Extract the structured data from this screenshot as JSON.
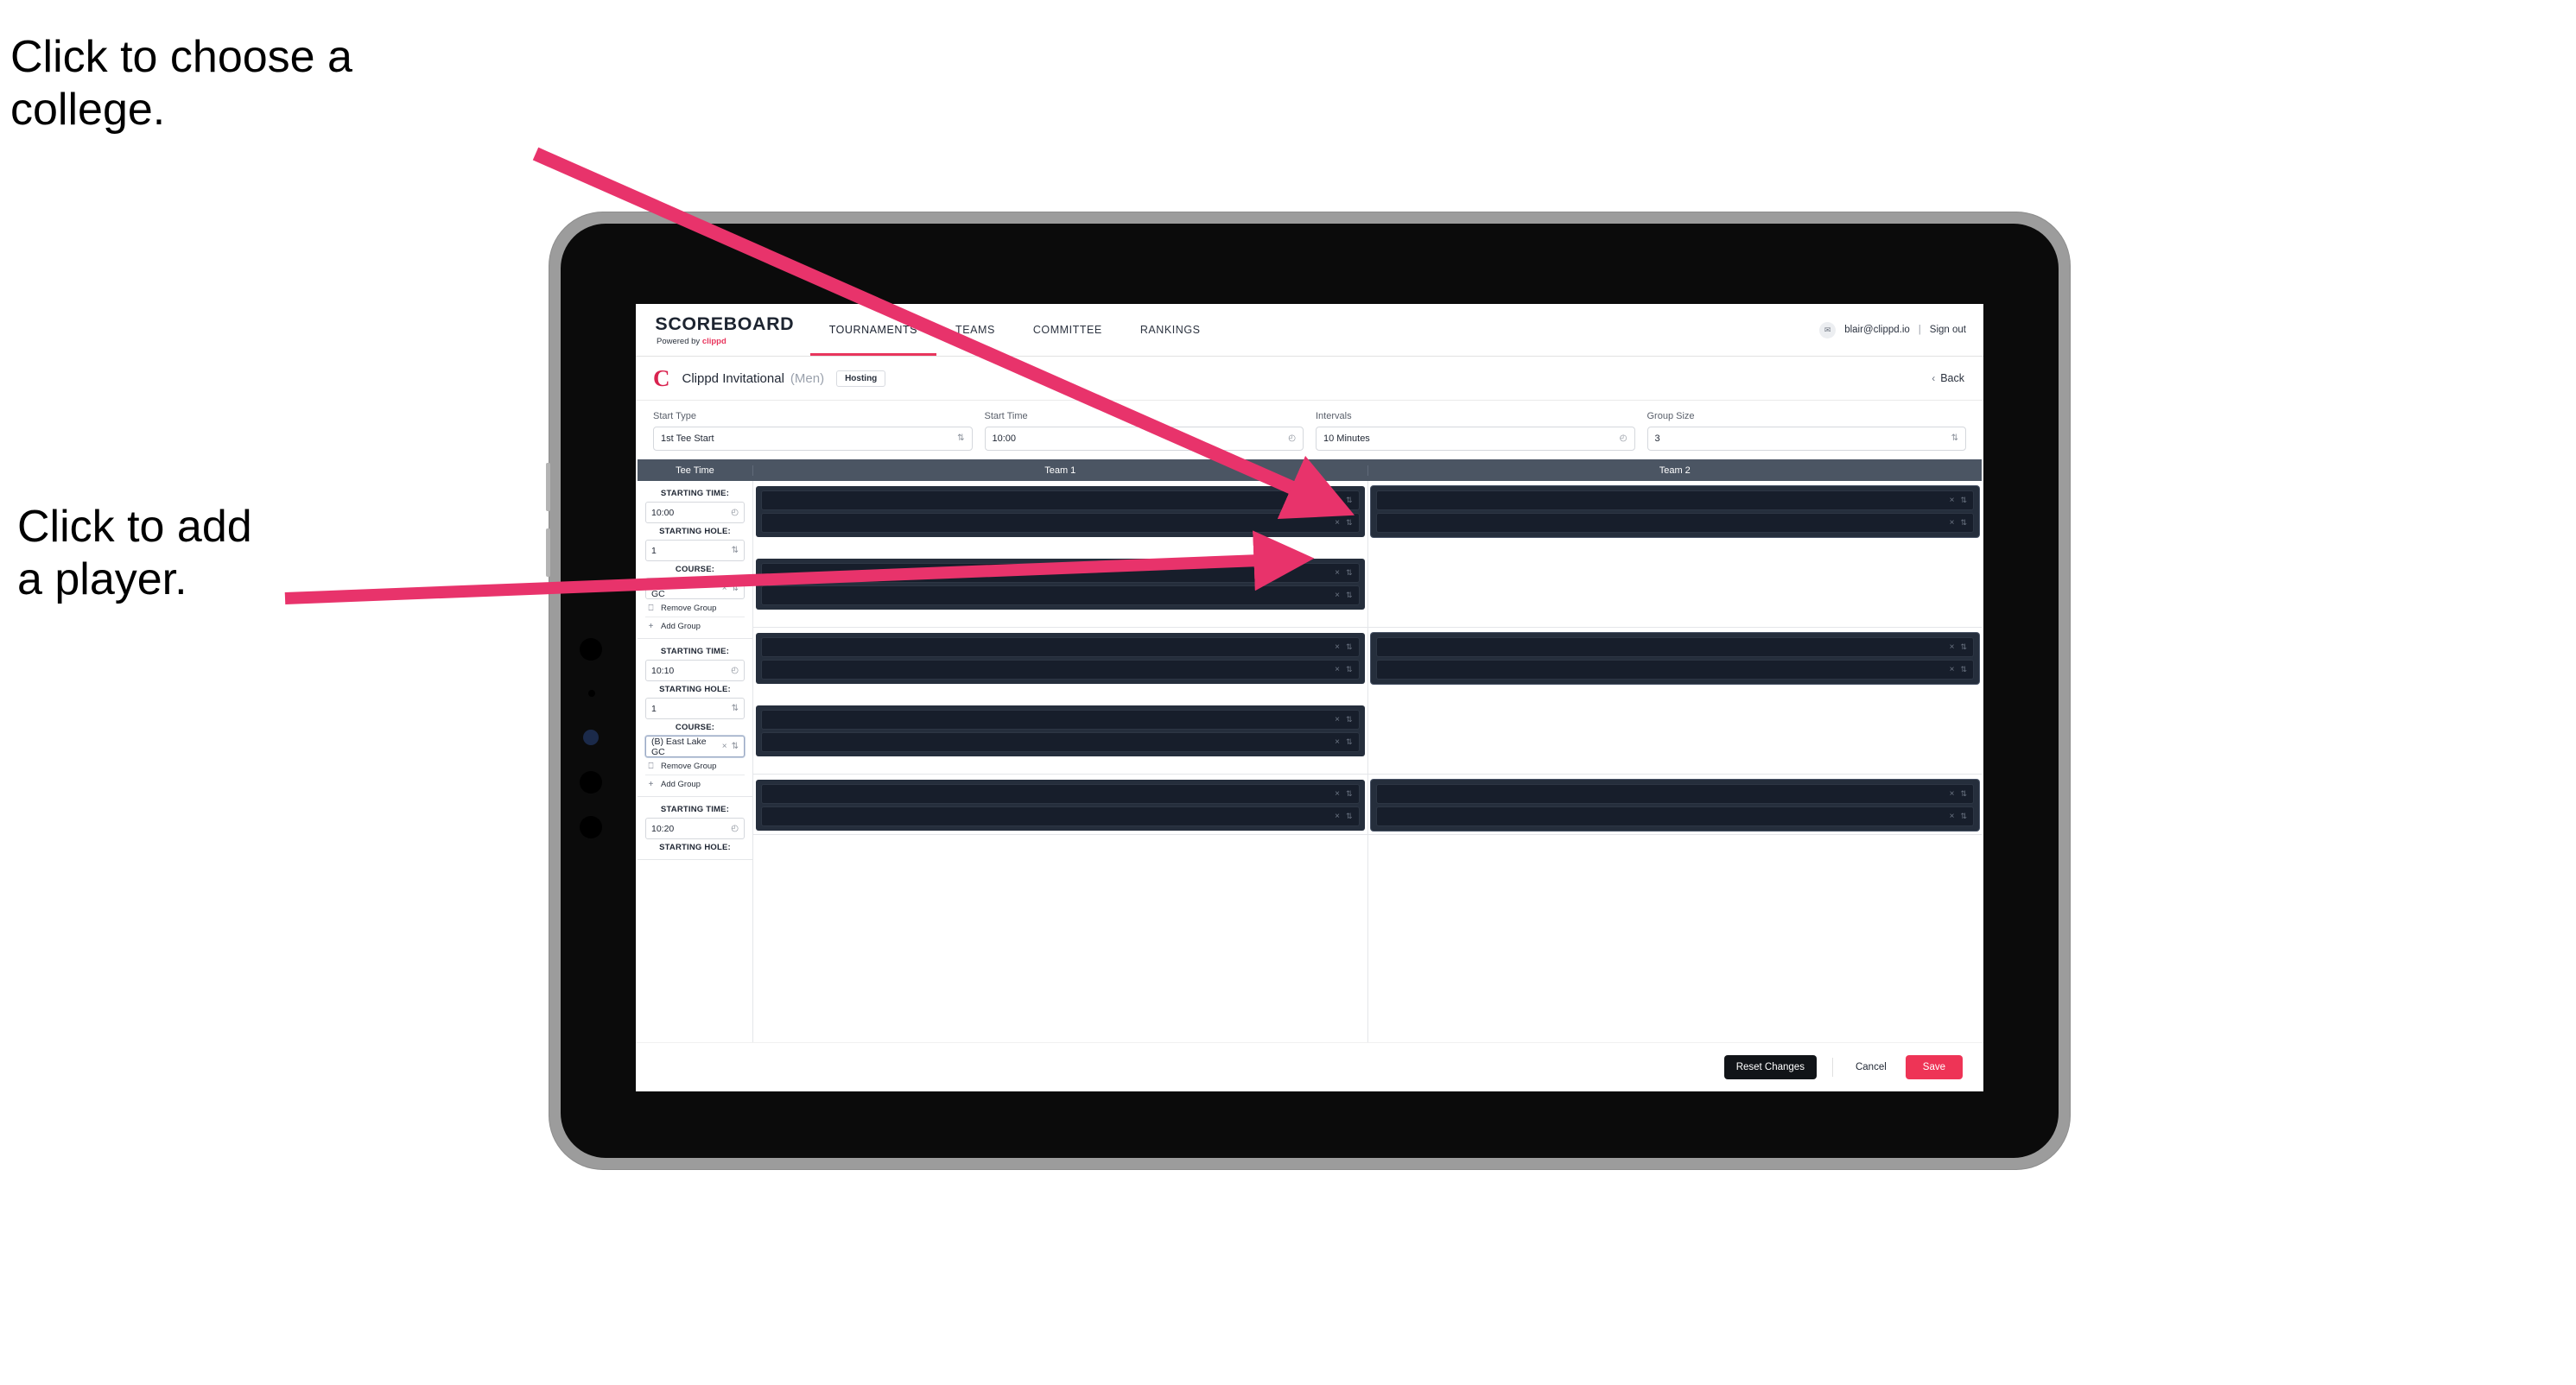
{
  "annotations": [
    {
      "id": "choose-college",
      "text": "Click to choose a\ncollege."
    },
    {
      "id": "add-player",
      "text": "Click to add\na player."
    }
  ],
  "navbar": {
    "brand_main": "SCOREBOARD",
    "brand_sub_prefix": "Powered by ",
    "brand_sub_name": "clippd",
    "items": [
      {
        "label": "TOURNAMENTS",
        "active": true
      },
      {
        "label": "TEAMS",
        "active": false
      },
      {
        "label": "COMMITTEE",
        "active": false
      },
      {
        "label": "RANKINGS",
        "active": false
      }
    ],
    "avatar_glyph": "✉",
    "email": "blair@clippd.io",
    "separator": "|",
    "sign_out": "Sign out"
  },
  "tournament": {
    "logo_letter": "C",
    "name": "Clippd Invitational",
    "gender": "(Men)",
    "badge": "Hosting",
    "back_label": "Back",
    "back_chevron": "‹"
  },
  "settings": {
    "fields": [
      {
        "label": "Start Type",
        "value": "1st Tee Start",
        "icon": "stepper-icon",
        "glyph": "⇅"
      },
      {
        "label": "Start Time",
        "value": "10:00",
        "icon": "clock-icon",
        "glyph": "◴"
      },
      {
        "label": "Intervals",
        "value": "10 Minutes",
        "icon": "clock-icon",
        "glyph": "◴"
      },
      {
        "label": "Group Size",
        "value": "3",
        "icon": "stepper-icon",
        "glyph": "⇅"
      }
    ]
  },
  "table": {
    "headers": [
      "Tee Time",
      "Team 1",
      "Team 2"
    ],
    "labels": {
      "starting_time": "STARTING TIME:",
      "starting_hole": "STARTING HOLE:",
      "course": "COURSE:",
      "remove_group": "Remove Group",
      "add_group": "Add Group",
      "remove_icon": "Ὕ1",
      "add_icon": "+",
      "clock_glyph": "◴",
      "stepper_glyph": "⇅",
      "clear_glyph": "×"
    },
    "tee_rows": [
      {
        "starting_time": "10:00",
        "starting_hole": "1",
        "course": "(A) Peachtree GC",
        "course_focused": false,
        "team1_groups": [
          {
            "players": [
              "",
              ""
            ]
          },
          {
            "players": [
              "",
              ""
            ]
          }
        ],
        "team2_groups": [
          {
            "players": [
              "",
              ""
            ]
          }
        ]
      },
      {
        "starting_time": "10:10",
        "starting_hole": "1",
        "course": "(B) East Lake GC",
        "course_focused": true,
        "team1_groups": [
          {
            "players": [
              "",
              ""
            ]
          },
          {
            "players": [
              "",
              ""
            ]
          }
        ],
        "team2_groups": [
          {
            "players": [
              "",
              ""
            ]
          }
        ]
      },
      {
        "starting_time": "10:20",
        "starting_hole": "",
        "course": "",
        "course_focused": false,
        "team1_groups": [
          {
            "players": [
              "",
              ""
            ]
          }
        ],
        "team2_groups": [
          {
            "players": [
              "",
              ""
            ]
          }
        ]
      }
    ]
  },
  "footer": {
    "reset": "Reset Changes",
    "cancel": "Cancel",
    "save": "Save"
  },
  "colors": {
    "accent_pink": "#ee3456",
    "brand_red": "#d9234f",
    "table_header": "#4b5563",
    "player_group_bg": "#252e3c",
    "player_row_bg": "#171e2b",
    "annotation_arrow": "#e8336b",
    "tablet_frame": "#9c9c9c"
  }
}
